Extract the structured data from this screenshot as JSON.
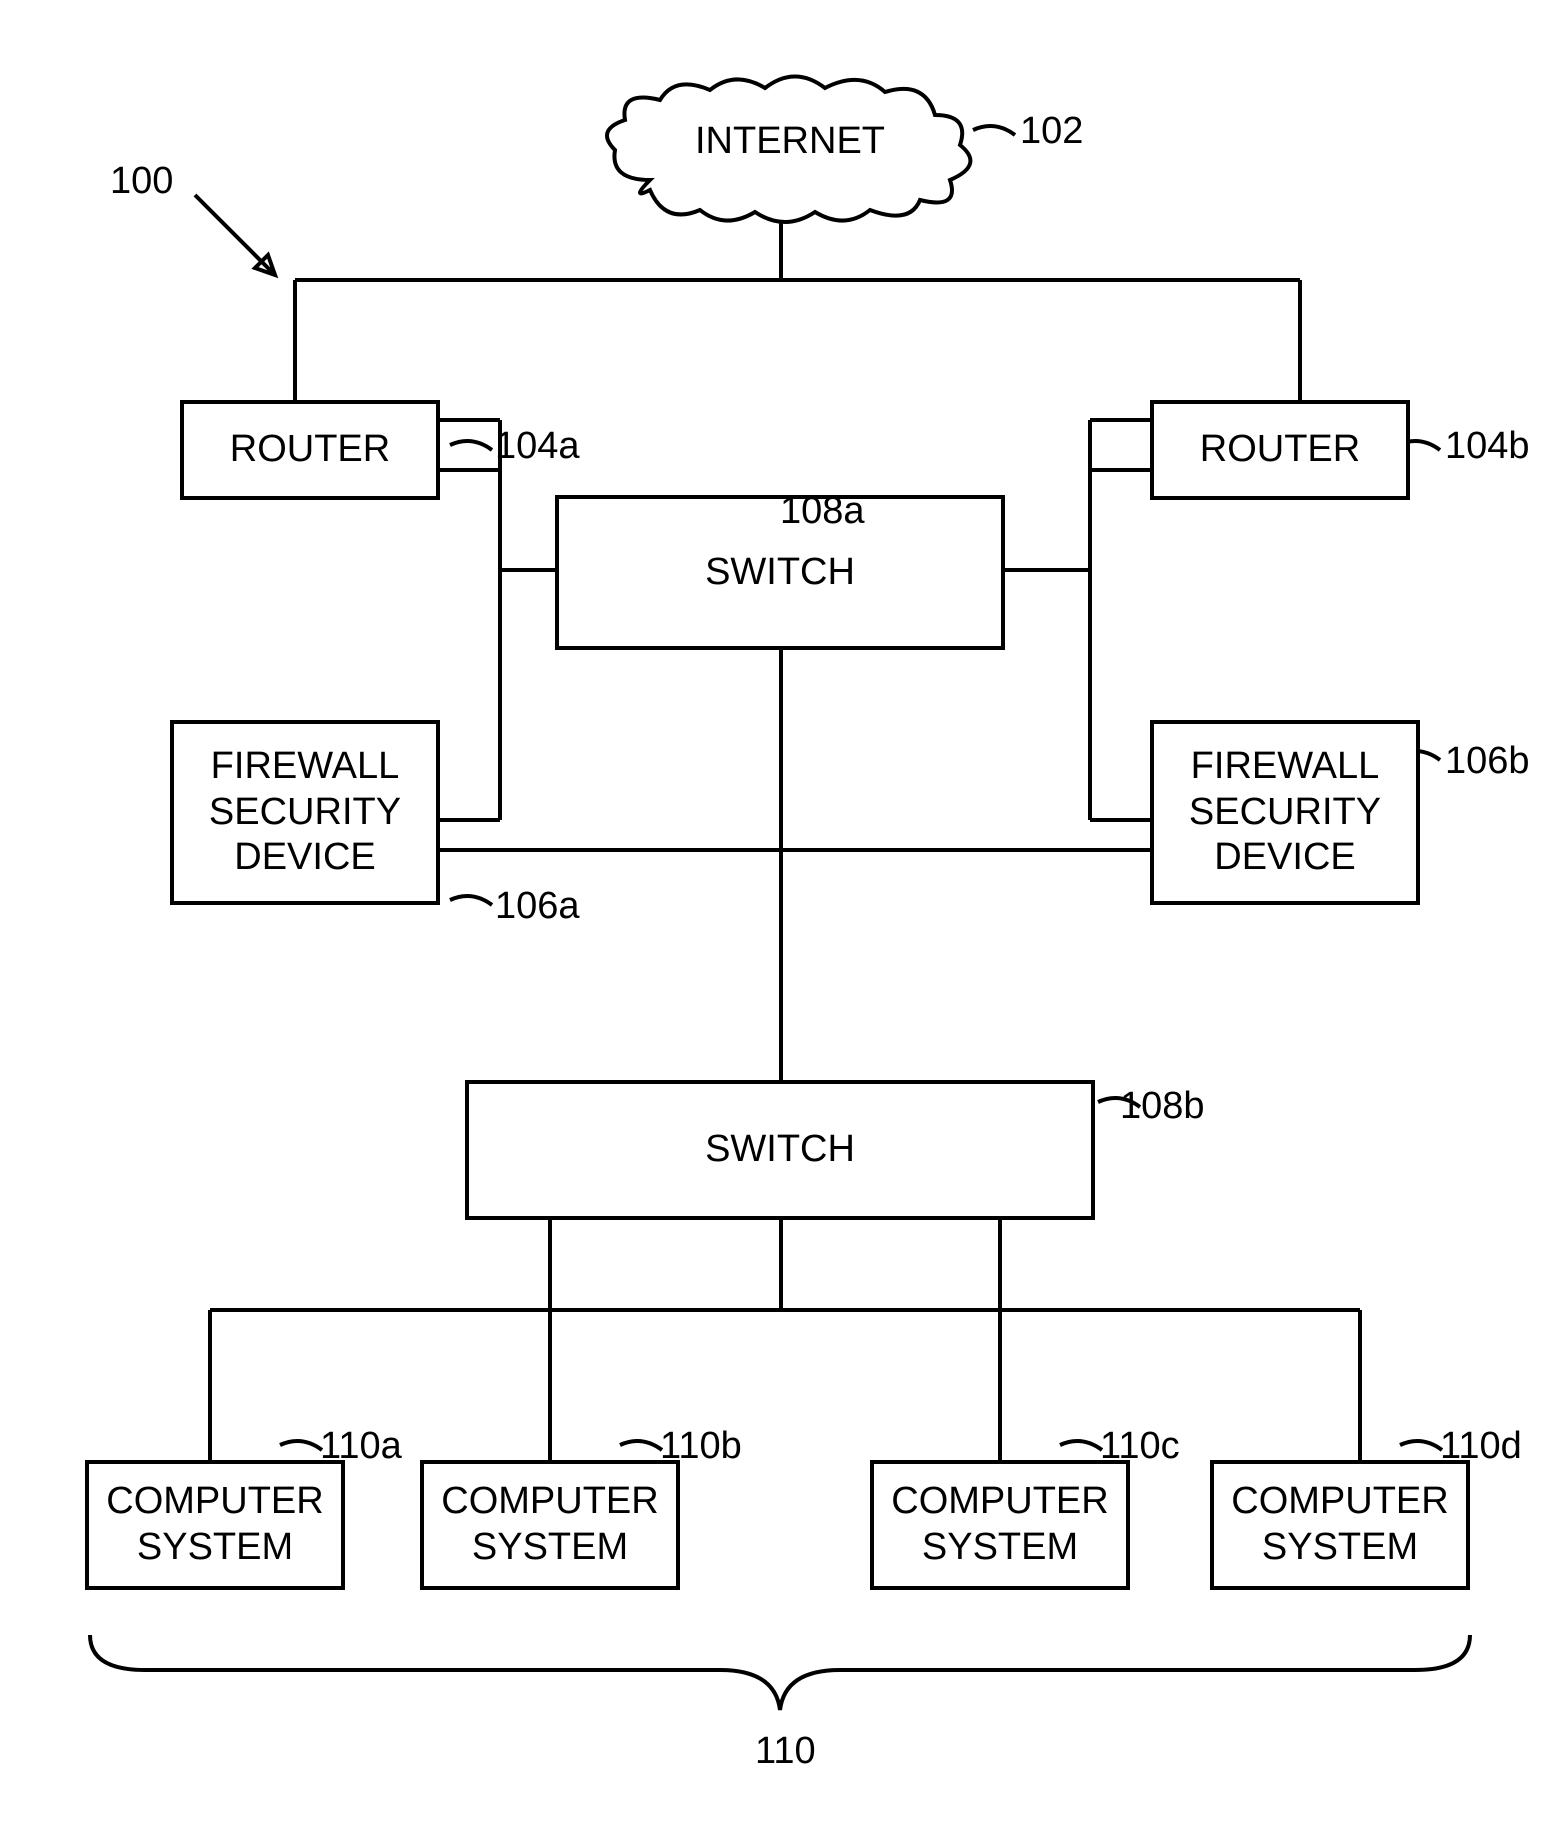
{
  "diagramRef": "100",
  "nodes": {
    "internet": {
      "label": "INTERNET",
      "ref": "102"
    },
    "routerA": {
      "label": "ROUTER",
      "ref": "104a"
    },
    "routerB": {
      "label": "ROUTER",
      "ref": "104b"
    },
    "switchA": {
      "label": "SWITCH",
      "ref": "108a"
    },
    "switchB": {
      "label": "SWITCH",
      "ref": "108b"
    },
    "firewallA": {
      "label": "FIREWALL SECURITY DEVICE",
      "ref": "106a"
    },
    "firewallB": {
      "label": "FIREWALL SECURITY DEVICE",
      "ref": "106b"
    },
    "computerA": {
      "label": "COMPUTER SYSTEM",
      "ref": "110a"
    },
    "computerB": {
      "label": "COMPUTER SYSTEM",
      "ref": "110b"
    },
    "computerC": {
      "label": "COMPUTER SYSTEM",
      "ref": "110c"
    },
    "computerD": {
      "label": "COMPUTER SYSTEM",
      "ref": "110d"
    },
    "computerGroup": {
      "ref": "110"
    }
  }
}
